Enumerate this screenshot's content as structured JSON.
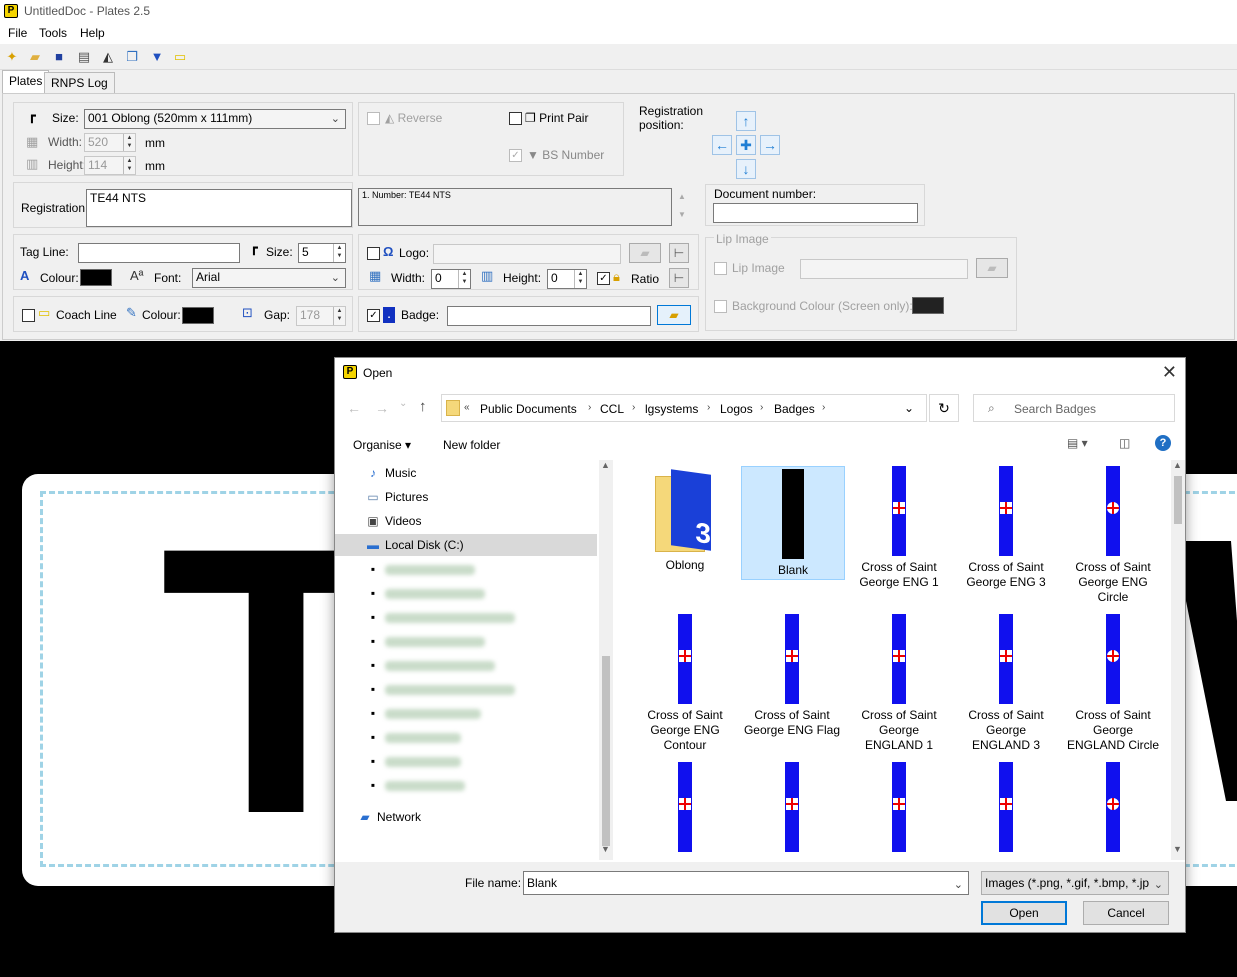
{
  "app": {
    "title": "UntitledDoc - Plates 2.5",
    "icon_letter": "P"
  },
  "menu": [
    "File",
    "Tools",
    "Help"
  ],
  "tabs": [
    "Plates",
    "RNPS Log"
  ],
  "plates": {
    "size_label": "Size:",
    "size_value": "001 Oblong (520mm x 111mm)",
    "width_label": "Width:",
    "width_value": "520",
    "height_label": "Height:",
    "height_value": "114",
    "unit": "mm",
    "reverse_label": "Reverse",
    "print_pair_label": "Print Pair",
    "bs_number_label": "BS Number",
    "registration_position_label": "Registration position:",
    "registration_label": "Registration:",
    "registration_value": "TE44 NTS",
    "log_value": "1. Number: TE44 NTS",
    "document_number_label": "Document number:",
    "document_number_value": "",
    "tag_line_label": "Tag Line:",
    "tag_size_label": "Size:",
    "tag_size_value": "5",
    "colour_label": "Colour:",
    "font_label": "Font:",
    "font_value": "Arial",
    "logo_label": "Logo:",
    "logo_width_label": "Width:",
    "logo_width_value": "0",
    "logo_height_label": "Height:",
    "logo_height_value": "0",
    "ratio_label": "Ratio",
    "lip_image_group": "Lip Image",
    "lip_image_label": "Lip Image",
    "bg_colour_label": "Background Colour (Screen only):",
    "coach_line_label": "Coach Line",
    "coach_colour_label": "Colour:",
    "gap_label": "Gap:",
    "gap_value": "178",
    "badge_label": "Badge:",
    "badge_value": ""
  },
  "dialog": {
    "title": "Open",
    "breadcrumb": [
      "Public Documents",
      "CCL",
      "lgsystems",
      "Logos",
      "Badges"
    ],
    "search_placeholder": "Search Badges",
    "organise": "Organise ▾",
    "new_folder": "New folder",
    "nav": [
      {
        "label": "Music",
        "icon": "music-icon"
      },
      {
        "label": "Pictures",
        "icon": "pictures-icon"
      },
      {
        "label": "Videos",
        "icon": "videos-icon"
      },
      {
        "label": "Local Disk (C:)",
        "icon": "local-disk-icon"
      },
      {
        "label": "Network",
        "icon": "network-icon"
      }
    ],
    "files": [
      {
        "name": "Oblong",
        "kind": "folder"
      },
      {
        "name": "Blank",
        "kind": "blank"
      },
      {
        "name": "Cross of Saint George ENG 1",
        "kind": "badge"
      },
      {
        "name": "Cross of Saint George ENG 3",
        "kind": "badge"
      },
      {
        "name": "Cross of Saint George ENG Circle",
        "kind": "badge"
      },
      {
        "name": "Cross of Saint George ENG Contour",
        "kind": "badge"
      },
      {
        "name": "Cross of Saint George ENG Flag",
        "kind": "badge"
      },
      {
        "name": "Cross of Saint George ENGLAND 1",
        "kind": "badge"
      },
      {
        "name": "Cross of Saint George ENGLAND 3",
        "kind": "badge"
      },
      {
        "name": "Cross of Saint George ENGLAND Circle",
        "kind": "badge"
      }
    ],
    "file_name_label": "File name:",
    "file_name_value": "Blank",
    "file_type_value": "Images (*.png, *.gif, *.bmp, *.jp",
    "open_button": "Open",
    "cancel_button": "Cancel"
  },
  "plate_preview": {
    "left_letter": "T"
  }
}
